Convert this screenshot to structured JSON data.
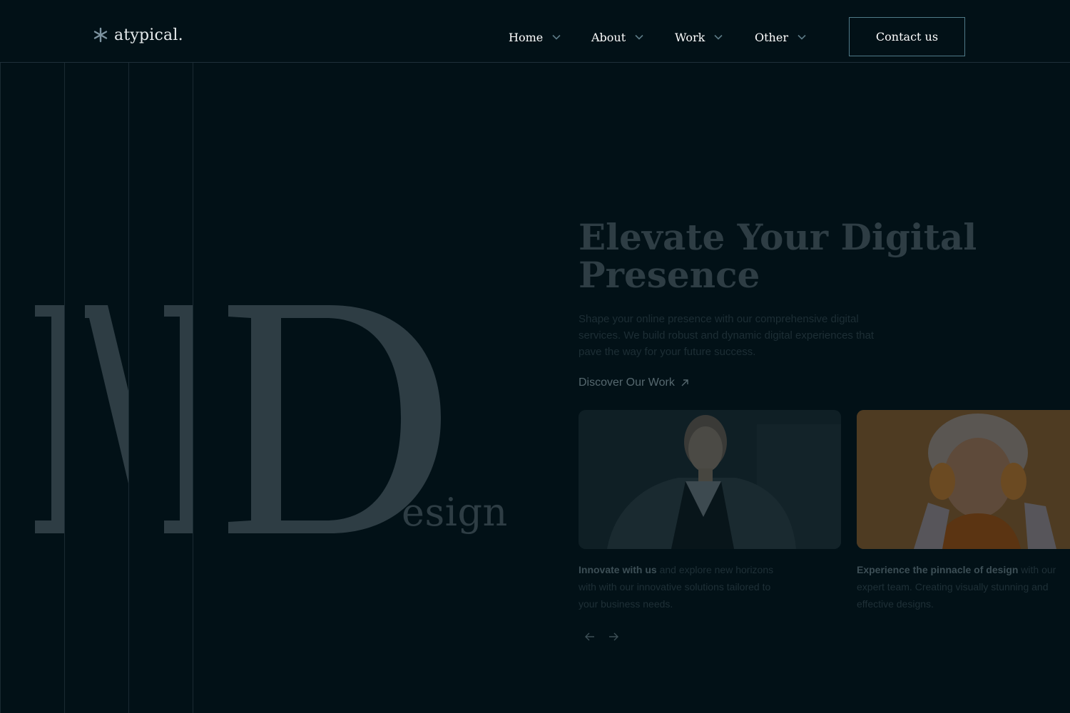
{
  "header": {
    "logo_text": "atypical.",
    "logo_icon": "asterisk-icon",
    "nav": [
      {
        "label": "Home"
      },
      {
        "label": "About"
      },
      {
        "label": "Work"
      },
      {
        "label": "Other"
      }
    ],
    "contact_label": "Contact us"
  },
  "hero": {
    "big_letter": "D",
    "big_word_suffix": "esign",
    "title_line1": "Elevate Your Digital",
    "title_line2": "Presence",
    "subtitle": "Shape your online presence with our comprehensive digital services. We build robust and dynamic digital experiences that pave the way for your future success.",
    "cta_label": "Discover Our Work",
    "cta_icon": "arrow-up-right-icon"
  },
  "cards": [
    {
      "bold": "Innovate with us",
      "text": " and explore new horizons with with our innovative solutions tailored to your business needs."
    },
    {
      "bold": "Experience the pinnacle of design",
      "text": " with our expert team. Creating visually stunning and effective designs."
    }
  ],
  "carousel": {
    "prev_icon": "arrow-left-icon",
    "next_icon": "arrow-right-icon"
  },
  "colors": {
    "background": "#021117",
    "muted_text": "#2e3d44",
    "button_border": "#4f7a88"
  }
}
